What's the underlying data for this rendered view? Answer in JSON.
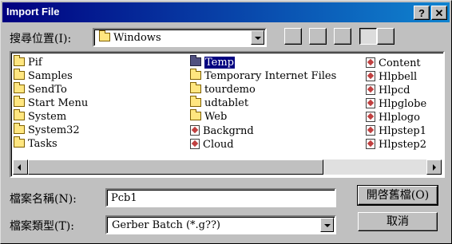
{
  "window": {
    "title": "Import File"
  },
  "title_buttons": {
    "help": "?",
    "close": "✕"
  },
  "look_in": {
    "label": "搜尋位置(I):",
    "value": "Windows"
  },
  "list": {
    "col1": [
      "Pif",
      "Samples",
      "SendTo",
      "Start Menu",
      "System",
      "System32",
      "Tasks"
    ],
    "col2": [
      "Temp",
      "Temporary Internet Files",
      "tourdemo",
      "udtablet",
      "Web",
      "Backgrnd",
      "Cloud"
    ],
    "col3": [
      "Content",
      "Hlpbell",
      "Hlpcd",
      "Hlpglobe",
      "Hlplogo",
      "Hlpstep1",
      "Hlpstep2"
    ]
  },
  "filename": {
    "label": "檔案名稱(N):",
    "value": "Pcb1"
  },
  "filetype": {
    "label": "檔案類型(T):",
    "value": "Gerber Batch (*.g??)"
  },
  "buttons": {
    "open": "開啓舊檔(O)",
    "cancel": "取消"
  }
}
